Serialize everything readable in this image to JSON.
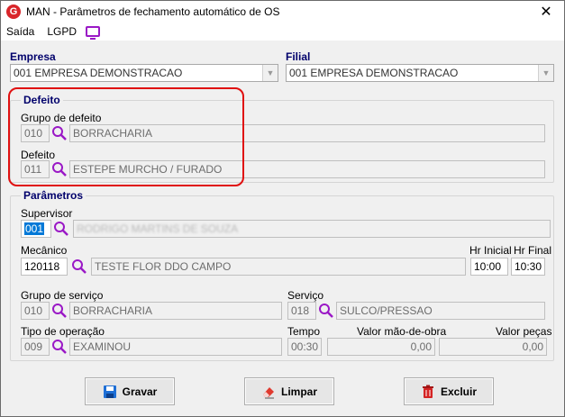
{
  "window": {
    "title": "MAN - Parâmetros de fechamento automático de OS",
    "app_icon_glyph": "G",
    "close_glyph": "✕"
  },
  "menu": {
    "items": [
      "Saída",
      "LGPD"
    ]
  },
  "header": {
    "empresa_label": "Empresa",
    "empresa_value": "001 EMPRESA DEMONSTRACAO",
    "filial_label": "Filial",
    "filial_value": "001 EMPRESA DEMONSTRACAO"
  },
  "defeito": {
    "title": "Defeito",
    "grupo_label": "Grupo de defeito",
    "grupo_code": "010",
    "grupo_desc": "BORRACHARIA",
    "defeito_label": "Defeito",
    "defeito_code": "011",
    "defeito_desc": "ESTEPE MURCHO / FURADO"
  },
  "parametros": {
    "title": "Parâmetros",
    "supervisor_label": "Supervisor",
    "supervisor_code": "001",
    "supervisor_name": "RODRIGO MARTINS DE SOUZA",
    "mecanico_label": "Mecânico",
    "mecanico_code": "120118",
    "mecanico_name": "TESTE FLOR DDO CAMPO",
    "hr_inicial_label": "Hr Inicial",
    "hr_inicial": "10:00",
    "hr_final_label": "Hr Final",
    "hr_final": "10:30",
    "grupo_servico_label": "Grupo de serviço",
    "grupo_servico_code": "010",
    "grupo_servico_desc": "BORRACHARIA",
    "servico_label": "Serviço",
    "servico_code": "018",
    "servico_desc": "SULCO/PRESSAO",
    "tipo_operacao_label": "Tipo de operação",
    "tipo_operacao_code": "009",
    "tipo_operacao_desc": "EXAMINOU",
    "tempo_label": "Tempo",
    "tempo": "00:30",
    "valor_mao_obra_label": "Valor mão-de-obra",
    "valor_mao_obra": "0,00",
    "valor_pecas_label": "Valor peças",
    "valor_pecas": "0,00"
  },
  "buttons": {
    "gravar": "Gravar",
    "limpar": "Limpar",
    "excluir": "Excluir"
  },
  "colors": {
    "accent_purple": "#9a18c6",
    "highlight_red": "#e01010",
    "label_blue": "#00006b"
  }
}
